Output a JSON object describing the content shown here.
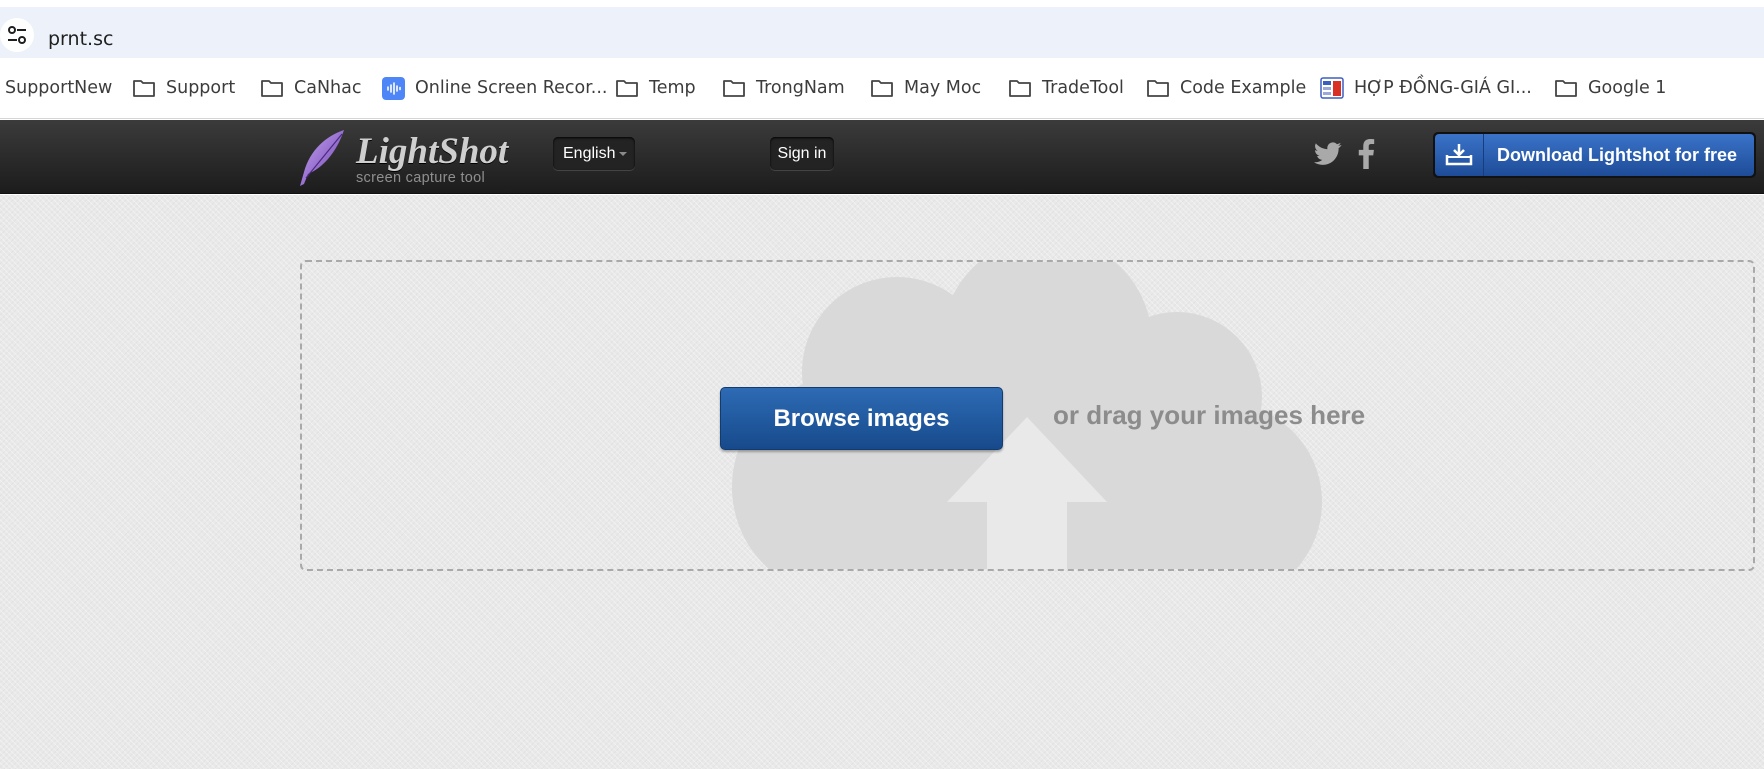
{
  "browser": {
    "url": "prnt.sc",
    "bookmarks": [
      {
        "label": "SupportNew",
        "icon": "none"
      },
      {
        "label": "Support",
        "icon": "folder-icon"
      },
      {
        "label": "CaNhac",
        "icon": "folder-icon"
      },
      {
        "label": "Online Screen Recor...",
        "icon": "audio-wave-icon"
      },
      {
        "label": "Temp",
        "icon": "folder-icon"
      },
      {
        "label": "TrongNam",
        "icon": "folder-icon"
      },
      {
        "label": "May Moc",
        "icon": "folder-icon"
      },
      {
        "label": "TradeTool",
        "icon": "folder-icon"
      },
      {
        "label": "Code Example",
        "icon": "folder-icon"
      },
      {
        "label": "HỢP ĐỒNG-GIÁ GI...",
        "icon": "spreadsheet-icon"
      },
      {
        "label": "Google 1",
        "icon": "folder-icon"
      }
    ]
  },
  "header": {
    "logo_title": "LightShot",
    "logo_subtitle": "screen capture tool",
    "language": "English",
    "signin_label": "Sign in",
    "download_label": "Download Lightshot for free",
    "colors": {
      "accent": "#2d6bb4",
      "header_bg": "#262626"
    }
  },
  "upload": {
    "browse_label": "Browse images",
    "drag_text": "or drag your images here"
  }
}
